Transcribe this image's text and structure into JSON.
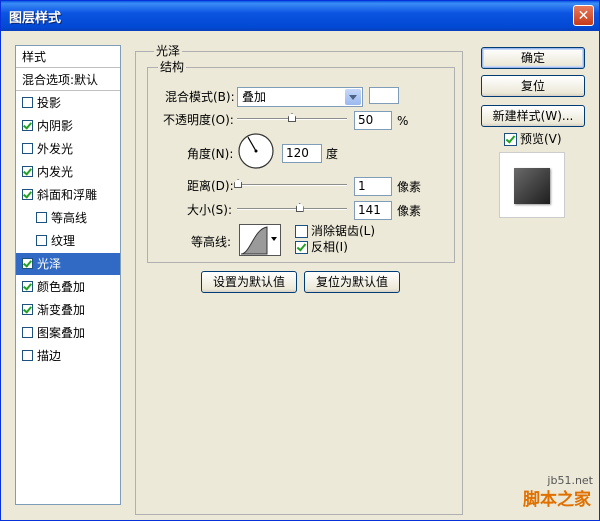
{
  "window": {
    "title": "图层样式",
    "close_label": "✕"
  },
  "sidebar": {
    "header": "样式",
    "blend_options": "混合选项:默认",
    "items": [
      {
        "label": "投影",
        "checked": false
      },
      {
        "label": "内阴影",
        "checked": true
      },
      {
        "label": "外发光",
        "checked": false
      },
      {
        "label": "内发光",
        "checked": true
      },
      {
        "label": "斜面和浮雕",
        "checked": true
      },
      {
        "label": "等高线",
        "checked": false
      },
      {
        "label": "纹理",
        "checked": false
      },
      {
        "label": "光泽",
        "checked": true,
        "selected": true
      },
      {
        "label": "颜色叠加",
        "checked": true
      },
      {
        "label": "渐变叠加",
        "checked": true
      },
      {
        "label": "图案叠加",
        "checked": false
      },
      {
        "label": "描边",
        "checked": false
      }
    ]
  },
  "satin": {
    "group_title": "光泽",
    "structure_title": "结构",
    "blend_mode_label": "混合模式(B):",
    "blend_mode_value": "叠加",
    "swatch_color": "#ffffff",
    "opacity_label": "不透明度(O):",
    "opacity_value": "50",
    "opacity_unit": "%",
    "opacity_fraction": 0.5,
    "angle_label": "角度(N):",
    "angle_value": "120",
    "angle_unit": "度",
    "distance_label": "距离(D):",
    "distance_value": "1",
    "distance_fraction": 0.01,
    "distance_unit": "像素",
    "size_label": "大小(S):",
    "size_value": "141",
    "size_fraction": 0.57,
    "size_unit": "像素",
    "contour_label": "等高线:",
    "antialias_label": "消除锯齿(L)",
    "antialias_checked": false,
    "invert_label": "反相(I)",
    "invert_checked": true,
    "set_default_label": "设置为默认值",
    "reset_default_label": "复位为默认值"
  },
  "actions": {
    "ok_label": "确定",
    "reset_label": "复位",
    "new_style_label": "新建样式(W)...",
    "preview_label": "预览(V)",
    "preview_checked": true
  },
  "watermark": {
    "url": "jb51.net",
    "text": "脚本之家"
  }
}
